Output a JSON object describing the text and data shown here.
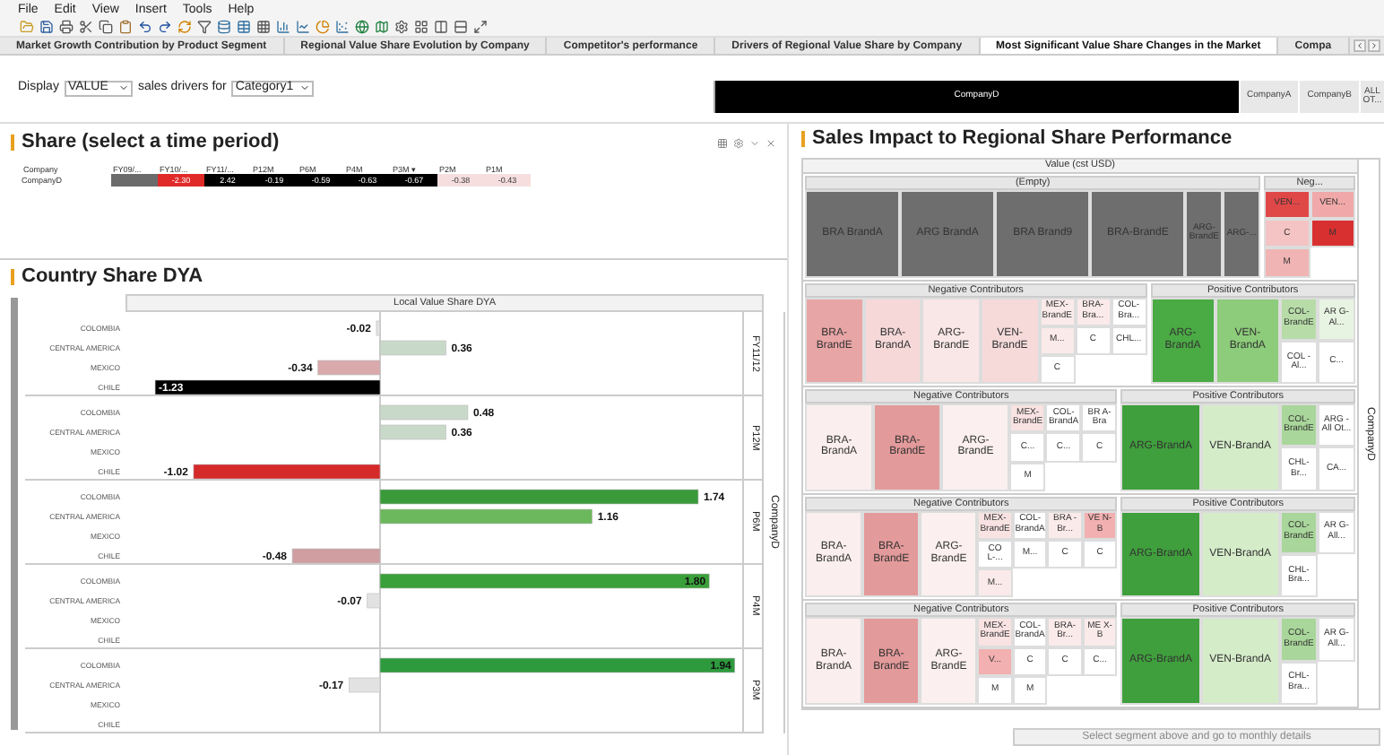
{
  "menu": [
    "File",
    "Edit",
    "View",
    "Insert",
    "Tools",
    "Help"
  ],
  "tabs": [
    {
      "label": "Market Growth Contribution by Product Segment",
      "selected": false
    },
    {
      "label": "Regional Value Share Evolution by Company",
      "selected": false
    },
    {
      "label": "Competitor's performance",
      "selected": false
    },
    {
      "label": "Drivers of Regional Value Share by Company",
      "selected": false
    },
    {
      "label": "Most Significant Value Share Changes in the Market",
      "selected": true
    },
    {
      "label": "Compa",
      "selected": false
    }
  ],
  "filters": {
    "display_label": "Display",
    "display_value": "VALUE",
    "middle_label": "sales drivers for",
    "category_value": "Category1"
  },
  "companies": [
    {
      "label": "CompanyD",
      "selected": true
    },
    {
      "label": "CompanyA",
      "selected": false
    },
    {
      "label": "CompanyB",
      "selected": false
    },
    {
      "label": "ALL OT...",
      "selected": false
    }
  ],
  "share_panel": {
    "title": "Share (select a time period)",
    "columns": [
      "Company",
      "FY09/...",
      "FY10/...",
      "FY11/...",
      "P12M",
      "P6M",
      "P4M",
      "P3M ▾",
      "P2M",
      "P1M"
    ],
    "rows": [
      {
        "cells": [
          {
            "text": "CompanyD"
          },
          {
            "color": "#6b6b6b"
          },
          {
            "text": "-2.30",
            "color": "#e02a2a"
          },
          {
            "text": "2.42",
            "color": "#000000"
          },
          {
            "text": "-0.19",
            "color": "#000000"
          },
          {
            "text": "-0.59",
            "color": "#000000"
          },
          {
            "text": "-0.63",
            "color": "#000000"
          },
          {
            "text": "-0.67",
            "color": "#000000"
          },
          {
            "text": "-0.38",
            "color": "#f6dede"
          },
          {
            "text": "-0.43",
            "color": "#f6dede"
          }
        ]
      }
    ]
  },
  "country_panel": {
    "title": "Country Share DYA",
    "chart_title": "Local Value Share DYA",
    "facet_label": "CompanyD",
    "facets": [
      {
        "label": "FY11/12",
        "chart_data": {
          "type": "bar",
          "orientation": "horizontal",
          "value_labels": [
            "-0.02",
            "0.36",
            "-0.34",
            "-1.23"
          ],
          "categories": [
            "COLOMBIA",
            "CENTRAL AMERICA",
            "MEXICO",
            "CHILE"
          ],
          "values": [
            -0.02,
            0.36,
            -0.34,
            -1.23
          ],
          "colors": [
            "#e2e2e2",
            "#c9d9c9",
            "#d9a9ab",
            "#000000"
          ]
        }
      },
      {
        "label": "P12M",
        "chart_data": {
          "type": "bar",
          "orientation": "horizontal",
          "value_labels": [
            "0.48",
            "0.36",
            null,
            "-1.02"
          ],
          "categories": [
            "COLOMBIA",
            "CENTRAL AMERICA",
            "MEXICO",
            "CHILE"
          ],
          "values": [
            0.48,
            0.36,
            null,
            -1.02
          ],
          "colors": [
            "#c9d9c9",
            "#c9d9c9",
            null,
            "#d42a2a"
          ]
        }
      },
      {
        "label": "P6M",
        "chart_data": {
          "type": "bar",
          "orientation": "horizontal",
          "value_labels": [
            "1.74",
            "1.16",
            null,
            "-0.48"
          ],
          "categories": [
            "COLOMBIA",
            "CENTRAL AMERICA",
            "MEXICO",
            "CHILE"
          ],
          "values": [
            1.74,
            1.16,
            null,
            -0.48
          ],
          "colors": [
            "#3a9a3a",
            "#6cb85c",
            null,
            "#d09ea0"
          ]
        }
      },
      {
        "label": "P4M",
        "chart_data": {
          "type": "bar",
          "orientation": "horizontal",
          "value_labels": [
            "1.80",
            "-0.07",
            null,
            null
          ],
          "categories": [
            "COLOMBIA",
            "CENTRAL AMERICA",
            "MEXICO",
            "CHILE"
          ],
          "values": [
            1.8,
            -0.07,
            null,
            null
          ],
          "colors": [
            "#3aa03a",
            "#e2e2e2",
            null,
            null
          ]
        }
      },
      {
        "label": "P3M",
        "chart_data": {
          "type": "bar",
          "orientation": "horizontal",
          "value_labels": [
            "1.94",
            "-0.17",
            null,
            null
          ],
          "categories": [
            "COLOMBIA",
            "CENTRAL AMERICA",
            "MEXICO",
            "CHILE"
          ],
          "values": [
            1.94,
            -0.17,
            null,
            null
          ],
          "colors": [
            "#2e9a3e",
            "#e2e2e2",
            null,
            null
          ]
        }
      }
    ]
  },
  "impact_panel": {
    "title": "Sales Impact to Regional Share Performance",
    "header": "Value (cst USD)",
    "side_label": "CompanyD",
    "button": "Select segment above and go to monthly details",
    "rows": [
      {
        "groups": [
          {
            "title": "(Empty)",
            "cells": [
              {
                "label": "BRA BrandA",
                "color": "#6e6e6e",
                "kind": "large"
              },
              {
                "label": "ARG BrandA",
                "color": "#6e6e6e",
                "kind": "large"
              },
              {
                "label": "BRA Brand9",
                "color": "#6e6e6e",
                "kind": "large"
              },
              {
                "label": "BRA-BrandE",
                "color": "#6e6e6e",
                "kind": "large"
              },
              {
                "label": "ARG-BrandE",
                "color": "#6e6e6e",
                "kind": "small"
              },
              {
                "label": "ARG-...",
                "color": "#6e6e6e",
                "kind": "small"
              }
            ]
          },
          {
            "title": "Neg...",
            "cells": [
              {
                "label": "VEN...",
                "color": "#e04848",
                "kind": "small"
              },
              {
                "label": "VEN...",
                "color": "#f0a8a8",
                "kind": "small"
              },
              {
                "label": "C",
                "color": "#f4c4c4",
                "kind": "small"
              },
              {
                "label": "M",
                "color": "#d83030",
                "kind": "small"
              },
              {
                "label": "M",
                "color": "#f0b4b4",
                "kind": "small"
              }
            ]
          }
        ]
      },
      {
        "groups": [
          {
            "title": "Negative Contributors",
            "cells": [
              {
                "label": "BRA-BrandE",
                "color": "#e8a5a5",
                "kind": "large"
              },
              {
                "label": "BRA-BrandA",
                "color": "#f6d8d8",
                "kind": "large"
              },
              {
                "label": "ARG-BrandE",
                "color": "#f9e6e6",
                "kind": "large"
              },
              {
                "label": "VEN-BrandE",
                "color": "#f6dada",
                "kind": "large"
              },
              {
                "label": "MEX-BrandE",
                "color": "#fbeaea",
                "kind": "small"
              },
              {
                "label": "BRA-Bra...",
                "color": "#fbeaea",
                "kind": "small"
              },
              {
                "label": "COL-Bra...",
                "color": "#ffffff",
                "kind": "small"
              },
              {
                "label": "M...",
                "color": "#fbeaea",
                "kind": "small"
              },
              {
                "label": "C",
                "color": "#ffffff",
                "kind": "small"
              },
              {
                "label": "CHL...",
                "color": "#ffffff",
                "kind": "small"
              },
              {
                "label": "C",
                "color": "#ffffff",
                "kind": "small"
              }
            ]
          },
          {
            "title": "Positive Contributors",
            "cells": [
              {
                "label": "ARG-BrandA",
                "color": "#4aaa44",
                "kind": "large"
              },
              {
                "label": "VEN-BrandA",
                "color": "#8ccc7a",
                "kind": "large"
              },
              {
                "label": "COL-BrandE",
                "color": "#b7dca8",
                "kind": "small"
              },
              {
                "label": "AR G-Al...",
                "color": "#e8f4e2",
                "kind": "small"
              },
              {
                "label": "COL -Al...",
                "color": "#ffffff",
                "kind": "small"
              },
              {
                "label": "C...",
                "color": "#ffffff",
                "kind": "small"
              }
            ]
          }
        ]
      },
      {
        "groups": [
          {
            "title": "Negative Contributors",
            "cells": [
              {
                "label": "BRA-BrandA",
                "color": "#fbeeee",
                "kind": "large"
              },
              {
                "label": "BRA-BrandE",
                "color": "#e39a9a",
                "kind": "large"
              },
              {
                "label": "ARG-BrandE",
                "color": "#fbefef",
                "kind": "large"
              },
              {
                "label": "MEX-BrandE",
                "color": "#f9e2e2",
                "kind": "small"
              },
              {
                "label": "COL-BrandA",
                "color": "#ffffff",
                "kind": "small"
              },
              {
                "label": "BR A-Bra",
                "color": "#ffffff",
                "kind": "small"
              },
              {
                "label": "C...",
                "color": "#ffffff",
                "kind": "small"
              },
              {
                "label": "C...",
                "color": "#ffffff",
                "kind": "small"
              },
              {
                "label": "C",
                "color": "#ffffff",
                "kind": "small"
              },
              {
                "label": "M",
                "color": "#ffffff",
                "kind": "small"
              }
            ]
          },
          {
            "title": "Positive Contributors",
            "cells": [
              {
                "label": "ARG-BrandA",
                "color": "#3f9f3c",
                "kind": "large"
              },
              {
                "label": "VEN-BrandA",
                "color": "#d5ecc9",
                "kind": "large"
              },
              {
                "label": "COL-BrandE",
                "color": "#a9d69a",
                "kind": "small"
              },
              {
                "label": "ARG -All Ot...",
                "color": "#ffffff",
                "kind": "small"
              },
              {
                "label": "CHL-Br...",
                "color": "#ffffff",
                "kind": "small"
              },
              {
                "label": "CA...",
                "color": "#ffffff",
                "kind": "small"
              }
            ]
          }
        ]
      },
      {
        "groups": [
          {
            "title": "Negative Contributors",
            "cells": [
              {
                "label": "BRA-BrandA",
                "color": "#fbeeee",
                "kind": "large"
              },
              {
                "label": "BRA-BrandE",
                "color": "#e39a9a",
                "kind": "large"
              },
              {
                "label": "ARG-BrandE",
                "color": "#fbefef",
                "kind": "large"
              },
              {
                "label": "MEX-BrandE",
                "color": "#f9e2e2",
                "kind": "small"
              },
              {
                "label": "COL-BrandA",
                "color": "#ffffff",
                "kind": "small"
              },
              {
                "label": "BRA -Br...",
                "color": "#fbeaea",
                "kind": "small"
              },
              {
                "label": "VE N-B",
                "color": "#f2b0b0",
                "kind": "small"
              },
              {
                "label": "CO L-...",
                "color": "#ffffff",
                "kind": "small"
              },
              {
                "label": "M...",
                "color": "#ffffff",
                "kind": "small"
              },
              {
                "label": "C",
                "color": "#ffffff",
                "kind": "small"
              },
              {
                "label": "C",
                "color": "#ffffff",
                "kind": "small"
              },
              {
                "label": "M...",
                "color": "#fbeaea",
                "kind": "small"
              }
            ]
          },
          {
            "title": "Positive Contributors",
            "cells": [
              {
                "label": "ARG-BrandA",
                "color": "#3f9f3c",
                "kind": "large"
              },
              {
                "label": "VEN-BrandA",
                "color": "#d5ecc9",
                "kind": "large"
              },
              {
                "label": "COL-BrandE",
                "color": "#a9d69a",
                "kind": "small"
              },
              {
                "label": "AR G-All...",
                "color": "#ffffff",
                "kind": "small"
              },
              {
                "label": "CHL-Bra...",
                "color": "#ffffff",
                "kind": "small"
              }
            ]
          }
        ]
      },
      {
        "groups": [
          {
            "title": "Negative Contributors",
            "cells": [
              {
                "label": "BRA-BrandA",
                "color": "#fbeeee",
                "kind": "large"
              },
              {
                "label": "BRA-BrandE",
                "color": "#e39a9a",
                "kind": "large"
              },
              {
                "label": "ARG-BrandE",
                "color": "#fbefef",
                "kind": "large"
              },
              {
                "label": "MEX-BrandE",
                "color": "#f9e2e2",
                "kind": "small"
              },
              {
                "label": "COL-BrandA",
                "color": "#ffffff",
                "kind": "small"
              },
              {
                "label": "BRA-Br...",
                "color": "#fbeaea",
                "kind": "small"
              },
              {
                "label": "ME X-B",
                "color": "#fbeaea",
                "kind": "small"
              },
              {
                "label": "V...",
                "color": "#f2b0b0",
                "kind": "small"
              },
              {
                "label": "C",
                "color": "#ffffff",
                "kind": "small"
              },
              {
                "label": "C",
                "color": "#ffffff",
                "kind": "small"
              },
              {
                "label": "C...",
                "color": "#ffffff",
                "kind": "small"
              },
              {
                "label": "M",
                "color": "#ffffff",
                "kind": "small"
              },
              {
                "label": "M",
                "color": "#ffffff",
                "kind": "small"
              }
            ]
          },
          {
            "title": "Positive Contributors",
            "cells": [
              {
                "label": "ARG-BrandA",
                "color": "#3f9f3c",
                "kind": "large"
              },
              {
                "label": "VEN-BrandA",
                "color": "#d5ecc9",
                "kind": "large"
              },
              {
                "label": "COL-BrandE",
                "color": "#a9d69a",
                "kind": "small"
              },
              {
                "label": "AR G-All...",
                "color": "#ffffff",
                "kind": "small"
              },
              {
                "label": "CHL-Bra...",
                "color": "#ffffff",
                "kind": "small"
              }
            ]
          }
        ]
      }
    ]
  }
}
